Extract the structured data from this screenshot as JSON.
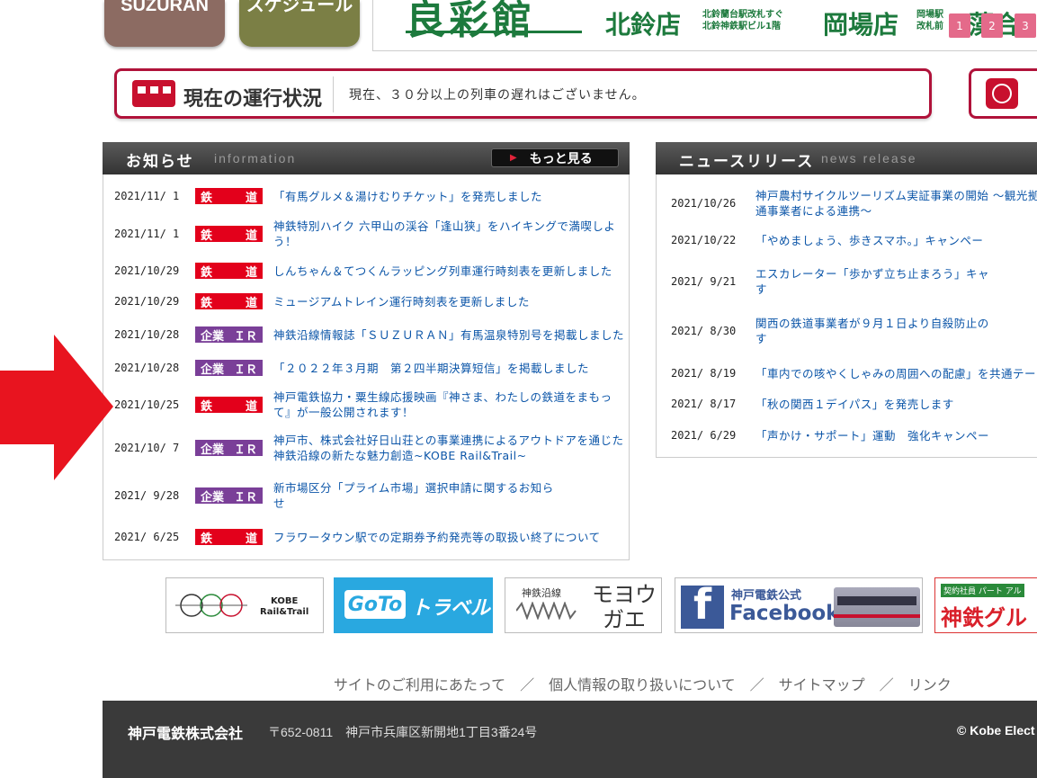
{
  "top": {
    "suzuran_label": "SUZURAN",
    "schedule_label": "スケジュール",
    "ad": {
      "main": "良彩館",
      "store1": "北鈴店",
      "store1_sub1": "北鈴蘭台駅改札すぐ",
      "store1_sub2": "北鈴神鉄駅ビル1階",
      "store2": "岡場店",
      "store2_sub1": "岡場駅",
      "store2_sub2": "改札前",
      "store3": "藻合"
    },
    "pager": [
      "1",
      "2",
      "3"
    ]
  },
  "status": {
    "title": "現在の運行状況",
    "message": "現在、３０分以上の列車の遅れはございません。"
  },
  "info": {
    "title": "お知らせ",
    "subtitle": "information",
    "more_label": "もっと見る",
    "items": [
      {
        "date": "2021/11/ 1",
        "cat": [
          "鉄",
          "道"
        ],
        "type": "rail",
        "text": [
          "「有馬グルメ＆湯けむりチケット」を発売しました"
        ]
      },
      {
        "date": "2021/11/ 1",
        "cat": [
          "鉄",
          "道"
        ],
        "type": "rail",
        "text": [
          "神鉄特別ハイク 六甲山の渓谷「逢山狭」をハイキングで満喫しよ",
          "う！"
        ]
      },
      {
        "date": "2021/10/29",
        "cat": [
          "鉄",
          "道"
        ],
        "type": "rail",
        "text": [
          "しんちゃん＆てつくんラッピング列車運行時刻表を更新しました"
        ]
      },
      {
        "date": "2021/10/29",
        "cat": [
          "鉄",
          "道"
        ],
        "type": "rail",
        "text": [
          "ミュージアムトレイン運行時刻表を更新しました"
        ]
      },
      {
        "date": "2021/10/28",
        "cat": [
          "企業",
          "ＩＲ"
        ],
        "type": "ir",
        "text": [
          "神鉄沿線情報誌「ＳＵＺＵＲＡＮ」有馬温泉特別号を掲載しました"
        ]
      },
      {
        "date": "2021/10/28",
        "cat": [
          "企業",
          "ＩＲ"
        ],
        "type": "ir",
        "text": [
          "「２０２２年３月期　第２四半期決算短信」を掲載しました"
        ]
      },
      {
        "date": "2021/10/25",
        "cat": [
          "鉄",
          "道"
        ],
        "type": "rail",
        "text": [
          "神戸電鉄協力・粟生線応援映画『神さま、わたしの鉄道をまもっ",
          "て』が一般公開されます！"
        ]
      },
      {
        "date": "2021/10/ 7",
        "cat": [
          "企業",
          "ＩＲ"
        ],
        "type": "ir",
        "text": [
          "神戸市、株式会社好日山荘との事業連携によるアウトドアを通じた",
          "神鉄沿線の新たな魅力創造~KOBE Rail&Trail~"
        ]
      },
      {
        "date": "2021/ 9/28",
        "cat": [
          "企業",
          "ＩＲ"
        ],
        "type": "ir",
        "text": [
          "新市場区分「プライム市場」選択申請に関するお知ら",
          "せ"
        ]
      },
      {
        "date": "2021/ 6/25",
        "cat": [
          "鉄",
          "道"
        ],
        "type": "rail",
        "text": [
          "フラワータウン駅での定期券予約発売等の取扱い終了について"
        ]
      }
    ]
  },
  "news": {
    "title": "ニュースリリース",
    "subtitle": "news release",
    "items": [
      {
        "date": "2021/10/26",
        "text": [
          "神戸農村サイクルツーリズム実証事業の開始 ～観光拠",
          "通事業者による連携～"
        ]
      },
      {
        "date": "2021/10/22",
        "text": [
          "「やめましょう、歩きスマホ。」キャンペー"
        ]
      },
      {
        "date": "2021/ 9/21",
        "text": [
          "エスカレーター「歩かず立ち止まろう」キャ",
          "す"
        ]
      },
      {
        "date": "2021/ 8/30",
        "text": [
          "関西の鉄道事業者が９月１日より自殺防止の",
          "す"
        ]
      },
      {
        "date": "2021/ 8/19",
        "text": [
          "「車内での咳やくしゃみの周囲への配慮」を共通テー"
        ]
      },
      {
        "date": "2021/ 8/17",
        "text": [
          "「秋の関西１デイパス」を発売します"
        ]
      },
      {
        "date": "2021/ 6/29",
        "text": [
          "「声かけ・サポート」運動　強化キャンペー"
        ]
      }
    ]
  },
  "logos": {
    "l1_line1": "KOBE",
    "l1_line2": "Rail&Trail",
    "l2": "GoTo",
    "l2b": "トラベル",
    "l3_small": "神鉄沿線",
    "l3_big1": "モヨウ",
    "l3_big2": "ガエ",
    "l4_small": "神戸電鉄公式",
    "l4_big": "Facebook",
    "l5_top": "契約社員 パート アル",
    "l5_big": "神鉄グル"
  },
  "footer_links": [
    "サイトのご利用にあたって",
    "個人情報の取り扱いについて",
    "サイトマップ",
    "リンク"
  ],
  "footer": {
    "company": "神戸電鉄株式会社",
    "address": "〒652-0811　神戸市兵庫区新開地1丁目3番24号",
    "copyright": "© Kobe Elect"
  },
  "colors": {
    "accent": "#b0123a",
    "rail": "#e3001b",
    "ir": "#7a3f98",
    "link": "#0b55a8",
    "arrow": "#e8141f"
  }
}
